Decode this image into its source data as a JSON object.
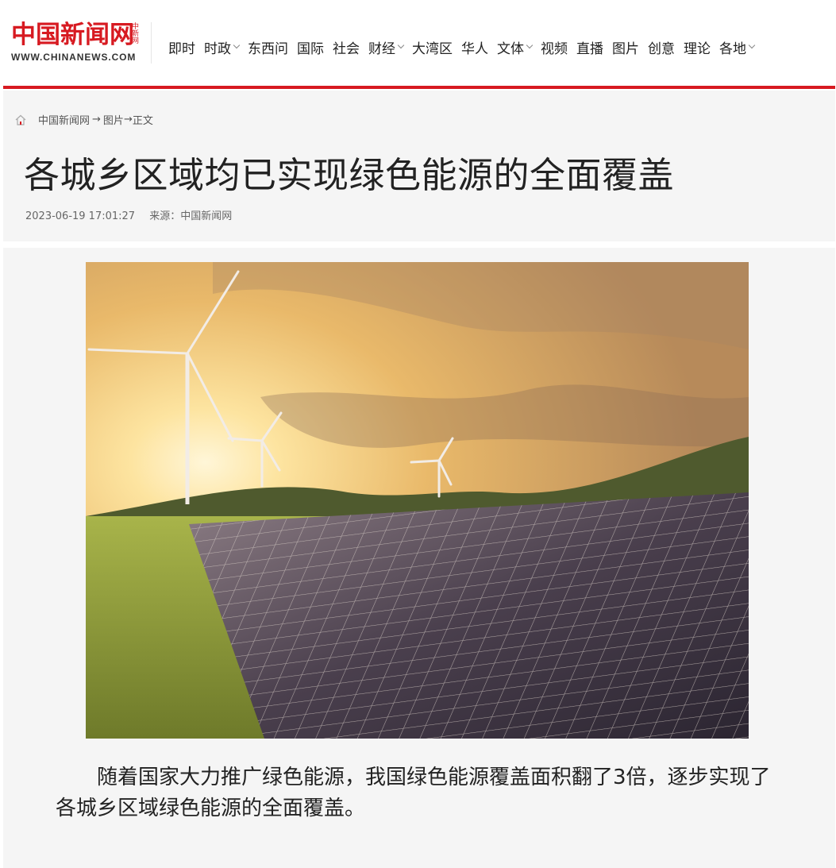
{
  "header": {
    "logo_cn": "中国新闻网",
    "logo_side": "中新网",
    "logo_en": "WWW.CHINANEWS.COM",
    "nav": [
      {
        "label": "即时",
        "dropdown": false
      },
      {
        "label": "时政",
        "dropdown": true
      },
      {
        "label": "东西问",
        "dropdown": false
      },
      {
        "label": "国际",
        "dropdown": false
      },
      {
        "label": "社会",
        "dropdown": false
      },
      {
        "label": "财经",
        "dropdown": true
      },
      {
        "label": "大湾区",
        "dropdown": false
      },
      {
        "label": "华人",
        "dropdown": false
      },
      {
        "label": "文体",
        "dropdown": true
      },
      {
        "label": "视频",
        "dropdown": false
      },
      {
        "label": "直播",
        "dropdown": false
      },
      {
        "label": "图片",
        "dropdown": false
      },
      {
        "label": "创意",
        "dropdown": false
      },
      {
        "label": "理论",
        "dropdown": false
      },
      {
        "label": "各地",
        "dropdown": true
      }
    ],
    "accent_color": "#d71a21"
  },
  "breadcrumb": {
    "items": [
      "中国新闻网",
      "图片",
      "正文"
    ],
    "sep1": " → ",
    "sep2": "→"
  },
  "article": {
    "title": "各城乡区域均已实现绿色能源的全面覆盖",
    "datetime": "2023-06-19 17:01:27",
    "source": "来源：中国新闻网",
    "image_icon": "solar-panels-and-wind-turbines-photo",
    "body": "随着国家大力推广绿色能源，我国绿色能源覆盖面积翻了3倍，逐步实现了各城乡区域绿色能源的全面覆盖。"
  }
}
